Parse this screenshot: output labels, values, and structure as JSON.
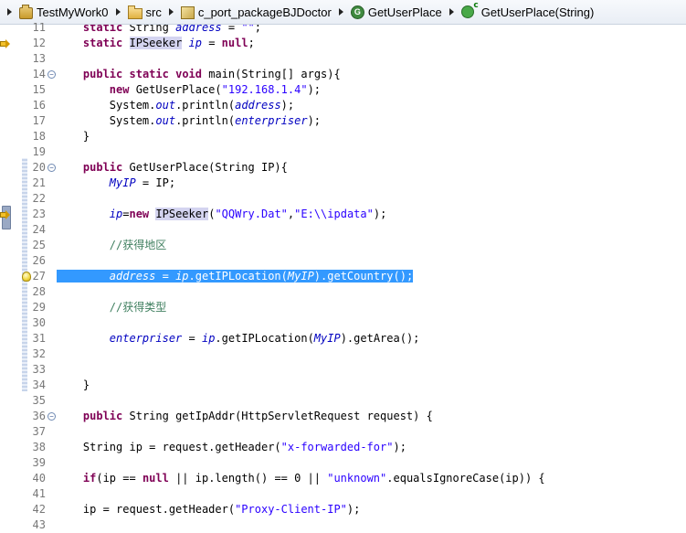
{
  "breadcrumb": [
    {
      "label": "TestMyWork0",
      "icon": "project-icon"
    },
    {
      "label": "src",
      "icon": "source-folder-icon"
    },
    {
      "label": "c_port_packageBJDoctor",
      "icon": "package-icon"
    },
    {
      "label": "GetUserPlace",
      "icon": "class-icon"
    },
    {
      "label": "GetUserPlace(String)",
      "icon": "constructor-icon"
    }
  ],
  "code": {
    "lines": [
      {
        "n": "11",
        "text": "    static String address = \"\";"
      },
      {
        "n": "12",
        "text": "    static IPSeeker ip = null;"
      },
      {
        "n": "13",
        "text": ""
      },
      {
        "n": "14",
        "text": "    public static void main(String[] args){"
      },
      {
        "n": "15",
        "text": "        new GetUserPlace(\"192.168.1.4\");"
      },
      {
        "n": "16",
        "text": "        System.out.println(address);"
      },
      {
        "n": "17",
        "text": "        System.out.println(enterpriser);"
      },
      {
        "n": "18",
        "text": "    }"
      },
      {
        "n": "19",
        "text": ""
      },
      {
        "n": "20",
        "text": "    public GetUserPlace(String IP){"
      },
      {
        "n": "21",
        "text": "        MyIP = IP;"
      },
      {
        "n": "22",
        "text": ""
      },
      {
        "n": "23",
        "text": "        ip=new IPSeeker(\"QQWry.Dat\",\"E:\\\\ipdata\");"
      },
      {
        "n": "24",
        "text": ""
      },
      {
        "n": "25",
        "text": "        //获得地区"
      },
      {
        "n": "26",
        "text": ""
      },
      {
        "n": "27",
        "text": "        address = ip.getIPLocation(MyIP).getCountry();"
      },
      {
        "n": "28",
        "text": ""
      },
      {
        "n": "29",
        "text": "        //获得类型"
      },
      {
        "n": "30",
        "text": ""
      },
      {
        "n": "31",
        "text": "        enterpriser = ip.getIPLocation(MyIP).getArea();"
      },
      {
        "n": "32",
        "text": ""
      },
      {
        "n": "33",
        "text": ""
      },
      {
        "n": "34",
        "text": "    }"
      },
      {
        "n": "35",
        "text": ""
      },
      {
        "n": "36",
        "text": "    public String getIpAddr(HttpServletRequest request) {"
      },
      {
        "n": "37",
        "text": ""
      },
      {
        "n": "38",
        "text": "    String ip = request.getHeader(\"x-forwarded-for\");"
      },
      {
        "n": "39",
        "text": ""
      },
      {
        "n": "40",
        "text": "    if(ip == null || ip.length() == 0 || \"unknown\".equalsIgnoreCase(ip)) {"
      },
      {
        "n": "41",
        "text": ""
      },
      {
        "n": "42",
        "text": "    ip = request.getHeader(\"Proxy-Client-IP\");"
      },
      {
        "n": "43",
        "text": ""
      }
    ]
  },
  "colors": {
    "keyword": "#7f0055",
    "string": "#2a00ff",
    "field": "#0000c0",
    "comment": "#3f7f5f",
    "selection": "#3399ff",
    "current_line": "#e8f2fe",
    "occurrence": "#d4d4f0"
  }
}
